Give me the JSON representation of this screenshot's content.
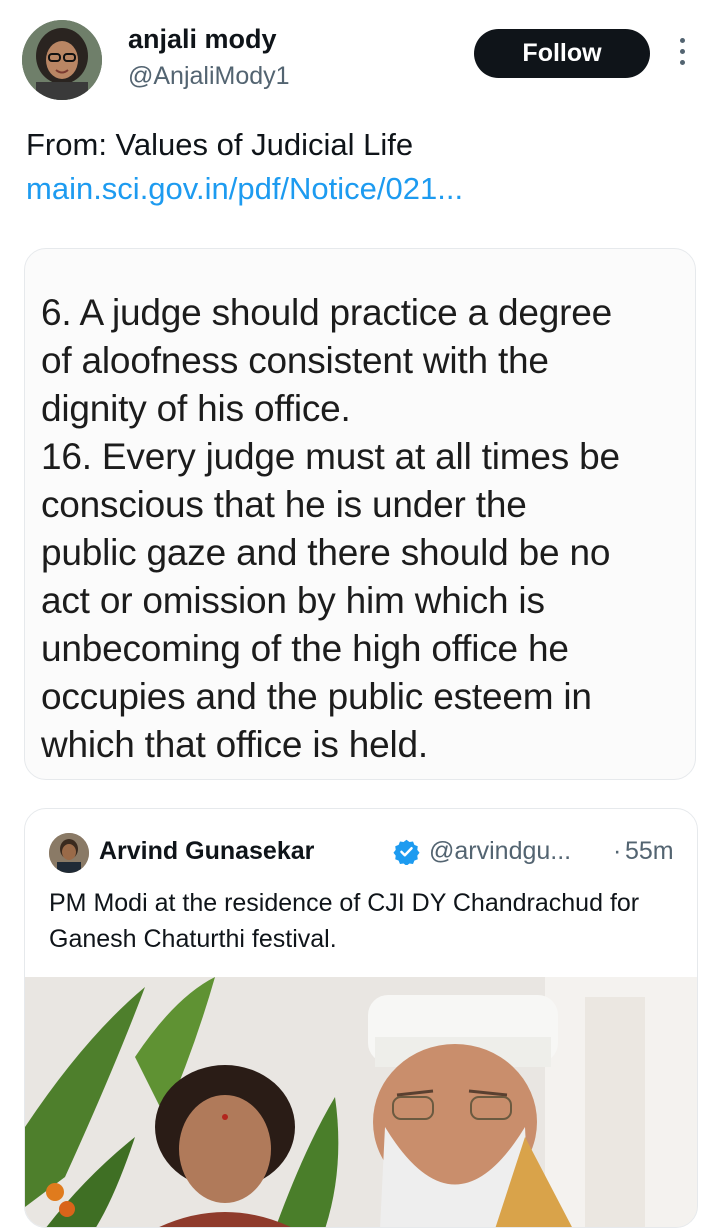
{
  "author": {
    "name": "anjali mody",
    "handle": "@AnjaliMody1"
  },
  "follow_label": "Follow",
  "tweet": {
    "text": "From: Values of Judicial Life",
    "link": "main.sci.gov.in/pdf/Notice/021..."
  },
  "media_text": "6. A judge should practice a degree\nof aloofness consistent with the\ndignity of his office.\n16. Every judge must at all times be\nconscious that he is under the\npublic gaze and there should be no\nact or omission by him which is\nunbecoming of the high office he\noccupies and the public esteem in\nwhich that office is held.",
  "quoted": {
    "name": "Arvind Gunasekar",
    "handle": "@arvindgu...",
    "separator": "·",
    "time": "55m",
    "text": "PM Modi at the residence of CJI DY Chandrachud for Ganesh Chaturthi festival."
  },
  "colors": {
    "link": "#1d9bf0",
    "verified": "#1d9bf0",
    "follow_bg": "#0f1419"
  },
  "icons": [
    "more-vertical-icon",
    "verified-badge-icon"
  ]
}
